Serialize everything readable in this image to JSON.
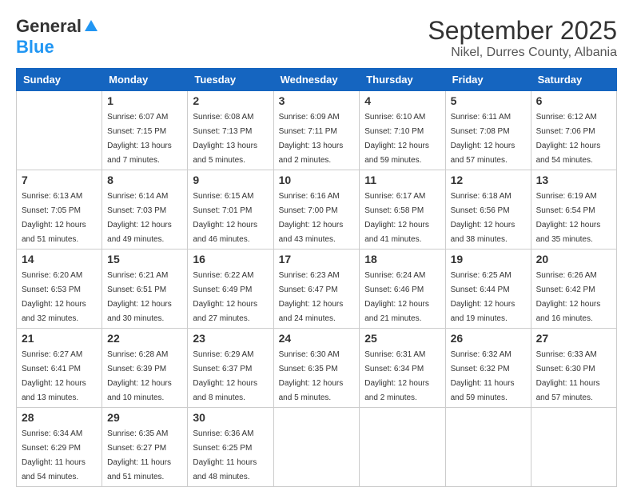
{
  "logo": {
    "general": "General",
    "blue": "Blue"
  },
  "title": {
    "month_year": "September 2025",
    "location": "Nikel, Durres County, Albania"
  },
  "headers": [
    "Sunday",
    "Monday",
    "Tuesday",
    "Wednesday",
    "Thursday",
    "Friday",
    "Saturday"
  ],
  "weeks": [
    [
      {
        "day": "",
        "sunrise": "",
        "sunset": "",
        "daylight": ""
      },
      {
        "day": "1",
        "sunrise": "Sunrise: 6:07 AM",
        "sunset": "Sunset: 7:15 PM",
        "daylight": "Daylight: 13 hours and 7 minutes."
      },
      {
        "day": "2",
        "sunrise": "Sunrise: 6:08 AM",
        "sunset": "Sunset: 7:13 PM",
        "daylight": "Daylight: 13 hours and 5 minutes."
      },
      {
        "day": "3",
        "sunrise": "Sunrise: 6:09 AM",
        "sunset": "Sunset: 7:11 PM",
        "daylight": "Daylight: 13 hours and 2 minutes."
      },
      {
        "day": "4",
        "sunrise": "Sunrise: 6:10 AM",
        "sunset": "Sunset: 7:10 PM",
        "daylight": "Daylight: 12 hours and 59 minutes."
      },
      {
        "day": "5",
        "sunrise": "Sunrise: 6:11 AM",
        "sunset": "Sunset: 7:08 PM",
        "daylight": "Daylight: 12 hours and 57 minutes."
      },
      {
        "day": "6",
        "sunrise": "Sunrise: 6:12 AM",
        "sunset": "Sunset: 7:06 PM",
        "daylight": "Daylight: 12 hours and 54 minutes."
      }
    ],
    [
      {
        "day": "7",
        "sunrise": "Sunrise: 6:13 AM",
        "sunset": "Sunset: 7:05 PM",
        "daylight": "Daylight: 12 hours and 51 minutes."
      },
      {
        "day": "8",
        "sunrise": "Sunrise: 6:14 AM",
        "sunset": "Sunset: 7:03 PM",
        "daylight": "Daylight: 12 hours and 49 minutes."
      },
      {
        "day": "9",
        "sunrise": "Sunrise: 6:15 AM",
        "sunset": "Sunset: 7:01 PM",
        "daylight": "Daylight: 12 hours and 46 minutes."
      },
      {
        "day": "10",
        "sunrise": "Sunrise: 6:16 AM",
        "sunset": "Sunset: 7:00 PM",
        "daylight": "Daylight: 12 hours and 43 minutes."
      },
      {
        "day": "11",
        "sunrise": "Sunrise: 6:17 AM",
        "sunset": "Sunset: 6:58 PM",
        "daylight": "Daylight: 12 hours and 41 minutes."
      },
      {
        "day": "12",
        "sunrise": "Sunrise: 6:18 AM",
        "sunset": "Sunset: 6:56 PM",
        "daylight": "Daylight: 12 hours and 38 minutes."
      },
      {
        "day": "13",
        "sunrise": "Sunrise: 6:19 AM",
        "sunset": "Sunset: 6:54 PM",
        "daylight": "Daylight: 12 hours and 35 minutes."
      }
    ],
    [
      {
        "day": "14",
        "sunrise": "Sunrise: 6:20 AM",
        "sunset": "Sunset: 6:53 PM",
        "daylight": "Daylight: 12 hours and 32 minutes."
      },
      {
        "day": "15",
        "sunrise": "Sunrise: 6:21 AM",
        "sunset": "Sunset: 6:51 PM",
        "daylight": "Daylight: 12 hours and 30 minutes."
      },
      {
        "day": "16",
        "sunrise": "Sunrise: 6:22 AM",
        "sunset": "Sunset: 6:49 PM",
        "daylight": "Daylight: 12 hours and 27 minutes."
      },
      {
        "day": "17",
        "sunrise": "Sunrise: 6:23 AM",
        "sunset": "Sunset: 6:47 PM",
        "daylight": "Daylight: 12 hours and 24 minutes."
      },
      {
        "day": "18",
        "sunrise": "Sunrise: 6:24 AM",
        "sunset": "Sunset: 6:46 PM",
        "daylight": "Daylight: 12 hours and 21 minutes."
      },
      {
        "day": "19",
        "sunrise": "Sunrise: 6:25 AM",
        "sunset": "Sunset: 6:44 PM",
        "daylight": "Daylight: 12 hours and 19 minutes."
      },
      {
        "day": "20",
        "sunrise": "Sunrise: 6:26 AM",
        "sunset": "Sunset: 6:42 PM",
        "daylight": "Daylight: 12 hours and 16 minutes."
      }
    ],
    [
      {
        "day": "21",
        "sunrise": "Sunrise: 6:27 AM",
        "sunset": "Sunset: 6:41 PM",
        "daylight": "Daylight: 12 hours and 13 minutes."
      },
      {
        "day": "22",
        "sunrise": "Sunrise: 6:28 AM",
        "sunset": "Sunset: 6:39 PM",
        "daylight": "Daylight: 12 hours and 10 minutes."
      },
      {
        "day": "23",
        "sunrise": "Sunrise: 6:29 AM",
        "sunset": "Sunset: 6:37 PM",
        "daylight": "Daylight: 12 hours and 8 minutes."
      },
      {
        "day": "24",
        "sunrise": "Sunrise: 6:30 AM",
        "sunset": "Sunset: 6:35 PM",
        "daylight": "Daylight: 12 hours and 5 minutes."
      },
      {
        "day": "25",
        "sunrise": "Sunrise: 6:31 AM",
        "sunset": "Sunset: 6:34 PM",
        "daylight": "Daylight: 12 hours and 2 minutes."
      },
      {
        "day": "26",
        "sunrise": "Sunrise: 6:32 AM",
        "sunset": "Sunset: 6:32 PM",
        "daylight": "Daylight: 11 hours and 59 minutes."
      },
      {
        "day": "27",
        "sunrise": "Sunrise: 6:33 AM",
        "sunset": "Sunset: 6:30 PM",
        "daylight": "Daylight: 11 hours and 57 minutes."
      }
    ],
    [
      {
        "day": "28",
        "sunrise": "Sunrise: 6:34 AM",
        "sunset": "Sunset: 6:29 PM",
        "daylight": "Daylight: 11 hours and 54 minutes."
      },
      {
        "day": "29",
        "sunrise": "Sunrise: 6:35 AM",
        "sunset": "Sunset: 6:27 PM",
        "daylight": "Daylight: 11 hours and 51 minutes."
      },
      {
        "day": "30",
        "sunrise": "Sunrise: 6:36 AM",
        "sunset": "Sunset: 6:25 PM",
        "daylight": "Daylight: 11 hours and 48 minutes."
      },
      {
        "day": "",
        "sunrise": "",
        "sunset": "",
        "daylight": ""
      },
      {
        "day": "",
        "sunrise": "",
        "sunset": "",
        "daylight": ""
      },
      {
        "day": "",
        "sunrise": "",
        "sunset": "",
        "daylight": ""
      },
      {
        "day": "",
        "sunrise": "",
        "sunset": "",
        "daylight": ""
      }
    ]
  ]
}
